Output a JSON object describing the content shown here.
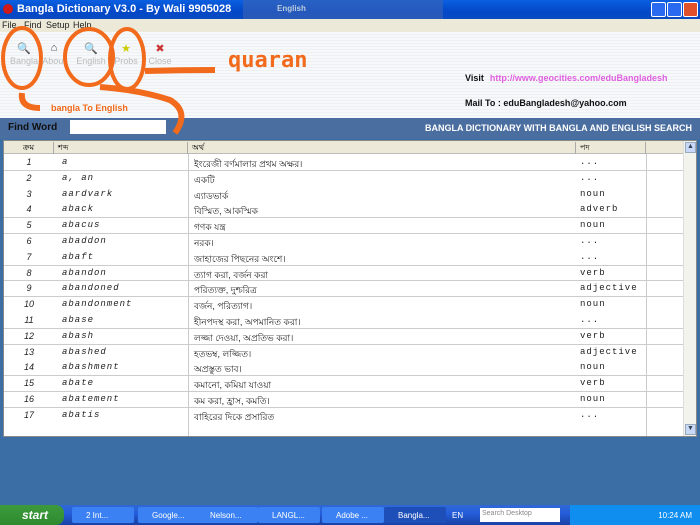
{
  "window": {
    "title": "Bangla Dictionary V3.0 - By Wali 9905028",
    "language_bar": "English"
  },
  "menu": [
    "File",
    "Find",
    "Setup",
    "Help"
  ],
  "toolbar": [
    {
      "label": "Bangla",
      "icon": "search-icon"
    },
    {
      "label": "About",
      "icon": "home-icon"
    },
    {
      "label": "English",
      "icon": "search-icon"
    },
    {
      "label": "Probs",
      "icon": "star-icon"
    },
    {
      "label": "Close",
      "icon": "close-icon"
    }
  ],
  "info": {
    "visit_label": "Visit",
    "visit_url": "http://www.geocities.com/eduBangladesh",
    "mail_label": "Mail To :",
    "mail": "eduBangladesh@yahoo.com"
  },
  "find": {
    "label": "Find Word",
    "value": "",
    "banner": "BANGLA DICTIONARY WITH BANGLA AND ENGLISH SEARCH"
  },
  "table": {
    "headers": [
      "ক্রম",
      "শব্দ",
      "অর্থ",
      "পদ"
    ],
    "rows": [
      [
        "1",
        "a",
        "ইংরেজী বর্ণমালার প্রথম অক্ষর।",
        "..."
      ],
      [
        "2",
        "a, an",
        "একটি",
        "..."
      ],
      [
        "3",
        "aardvark",
        "এ্যাডভার্ক",
        "noun"
      ],
      [
        "4",
        "aback",
        "বিস্মিত, আকস্মিক",
        "adverb"
      ],
      [
        "5",
        "abacus",
        "গণক যন্ত্র",
        "noun"
      ],
      [
        "6",
        "abaddon",
        "নরক।",
        "..."
      ],
      [
        "7",
        "abaft",
        "জাহাজের পিছনের অংশে।",
        "..."
      ],
      [
        "8",
        "abandon",
        "ত্যাগ করা, বর্জন করা",
        "verb"
      ],
      [
        "9",
        "abandoned",
        "পরিত্যক্ত, দুশ্চরিত্র",
        "adjective"
      ],
      [
        "10",
        "abandonment",
        "বর্জন, পরিত্যাগ।",
        "noun"
      ],
      [
        "11",
        "abase",
        "হীনপদস্থ করা, অপমানিত করা।",
        "..."
      ],
      [
        "12",
        "abash",
        "লজ্জা দেওয়া, অপ্রতিভ করা।",
        "verb"
      ],
      [
        "13",
        "abashed",
        "হতভম্ব, লজ্জিত।",
        "adjective"
      ],
      [
        "14",
        "abashment",
        "অপ্রস্তুত ভাব।",
        "noun"
      ],
      [
        "15",
        "abate",
        "কমানো, কমিয়া যাওয়া",
        "verb"
      ],
      [
        "16",
        "abatement",
        "কম করা, হ্রাস, কমতি।",
        "noun"
      ],
      [
        "17",
        "abatis",
        "বাহিরের দিকে প্রসারিত",
        "..."
      ]
    ]
  },
  "annotations": {
    "quaran": "quaran",
    "bangla_to_english": "bangla To English",
    "color": "#f26a1b"
  },
  "taskbar": {
    "start": "start",
    "tasks": [
      "2 Int...",
      "Google...",
      "Nelson...",
      "LANGL...",
      "Adobe ...",
      "Bangla..."
    ],
    "lang": "EN",
    "search_placeholder": "Search Desktop",
    "clock": "10:24 AM"
  }
}
